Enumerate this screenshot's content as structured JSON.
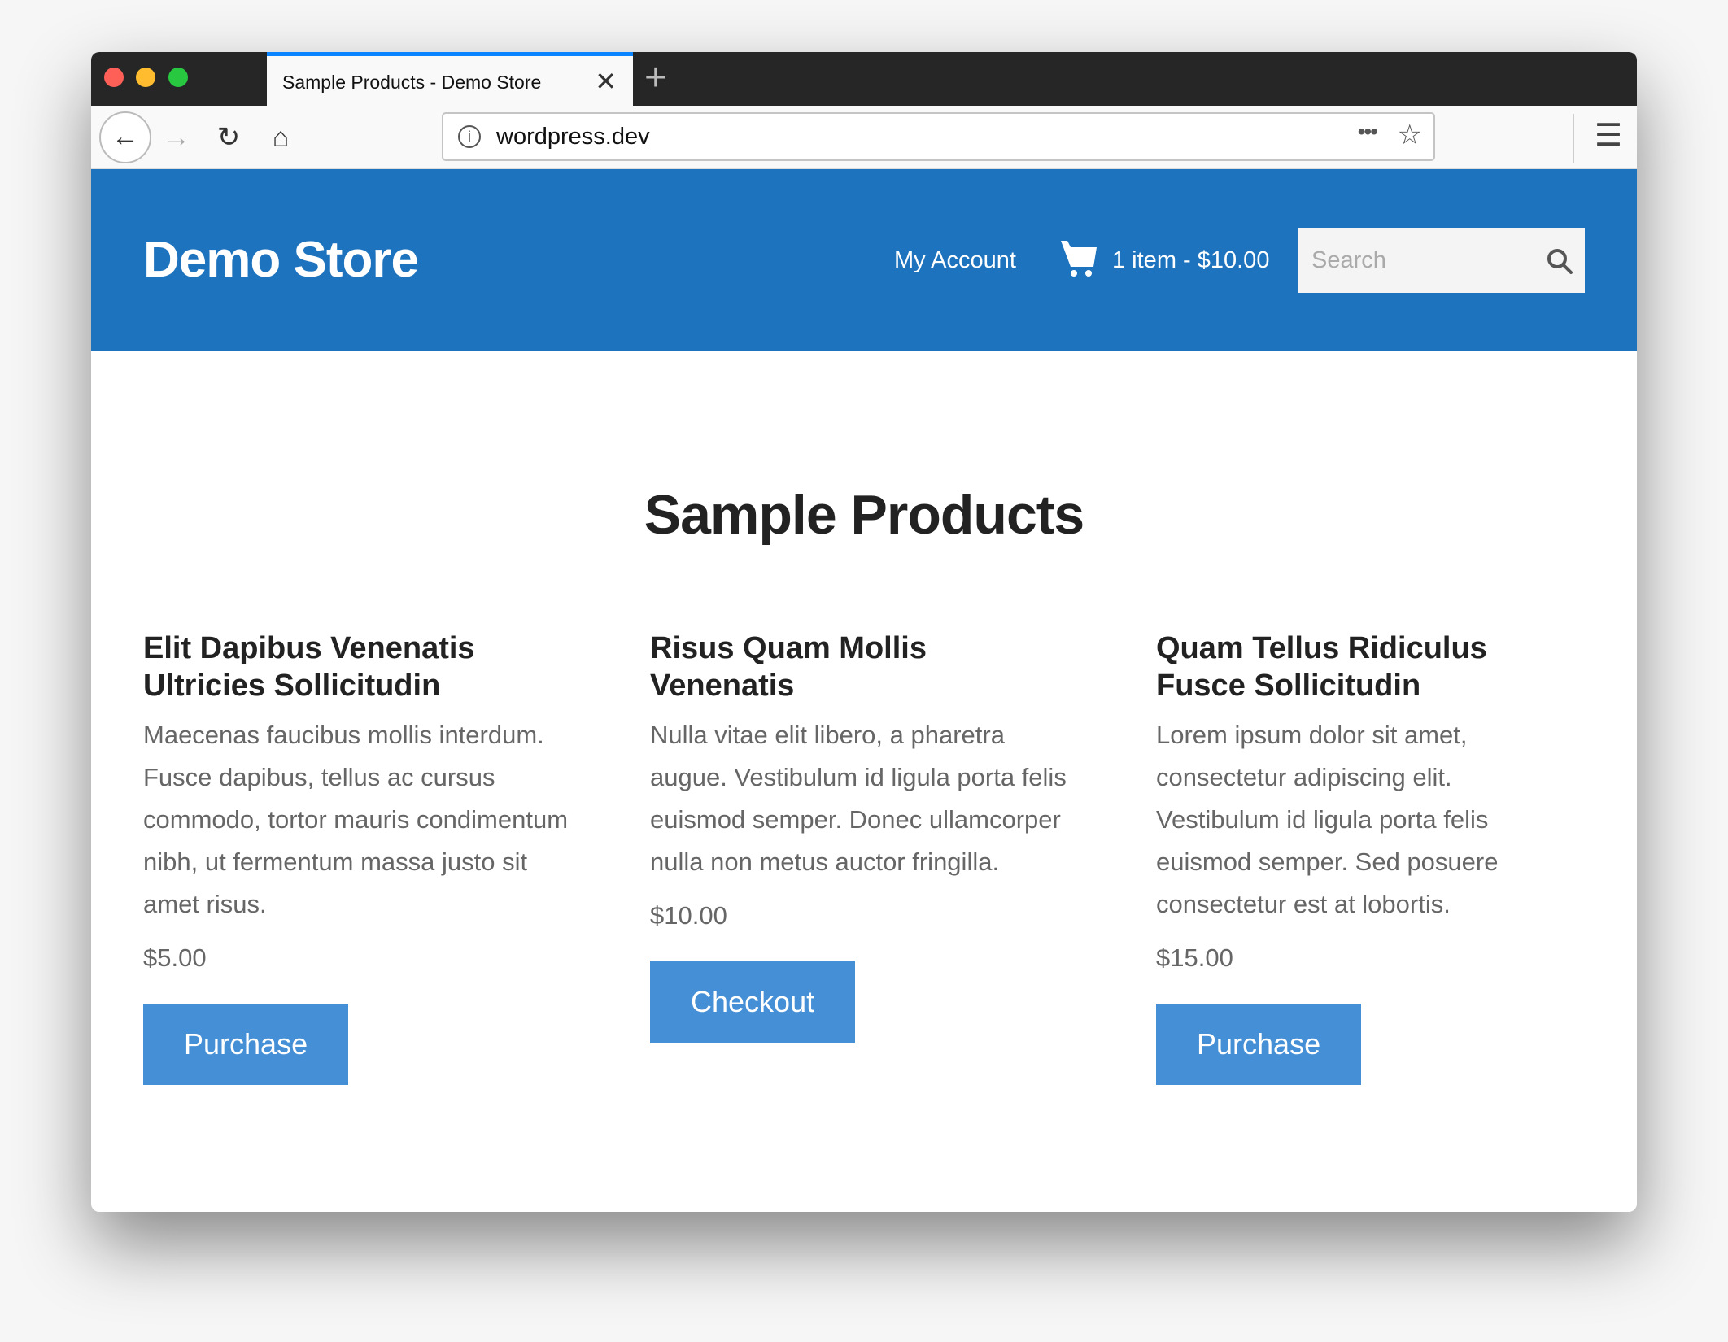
{
  "browser": {
    "tab_title": "Sample Products - Demo Store",
    "url": "wordpress.dev",
    "traffic_lights": {
      "close": "#fe5f57",
      "minimize": "#febc2e",
      "maximize": "#28c840"
    },
    "accent": "#0a84ff"
  },
  "header": {
    "brand": "Demo Store",
    "my_account": "My Account",
    "cart": "1 item - $10.00",
    "search_placeholder": "Search",
    "background": "#1e73be"
  },
  "main": {
    "title": "Sample Products",
    "products": [
      {
        "name": "Elit Dapibus Venenatis Ultricies Sollicitudin",
        "description": "Maecenas faucibus mollis interdum. Fusce dapibus, tellus ac cursus commodo, tortor mauris condimentum nibh, ut fermentum massa justo sit amet risus.",
        "price": "$5.00",
        "button": "Purchase"
      },
      {
        "name": "Risus Quam Mollis Venenatis",
        "description": "Nulla vitae elit libero, a pharetra augue. Vestibulum id ligula porta felis euismod semper. Donec ullamcorper nulla non metus auctor fringilla.",
        "price": "$10.00",
        "button": "Checkout"
      },
      {
        "name": "Quam Tellus Ridiculus Fusce Sollicitudin",
        "description": "Lorem ipsum dolor sit amet, consectetur adipiscing elit. Vestibulum id ligula porta felis euismod semper. Sed posuere consectetur est at lobortis.",
        "price": "$15.00",
        "button": "Purchase"
      }
    ],
    "button_color": "#458fd6"
  }
}
